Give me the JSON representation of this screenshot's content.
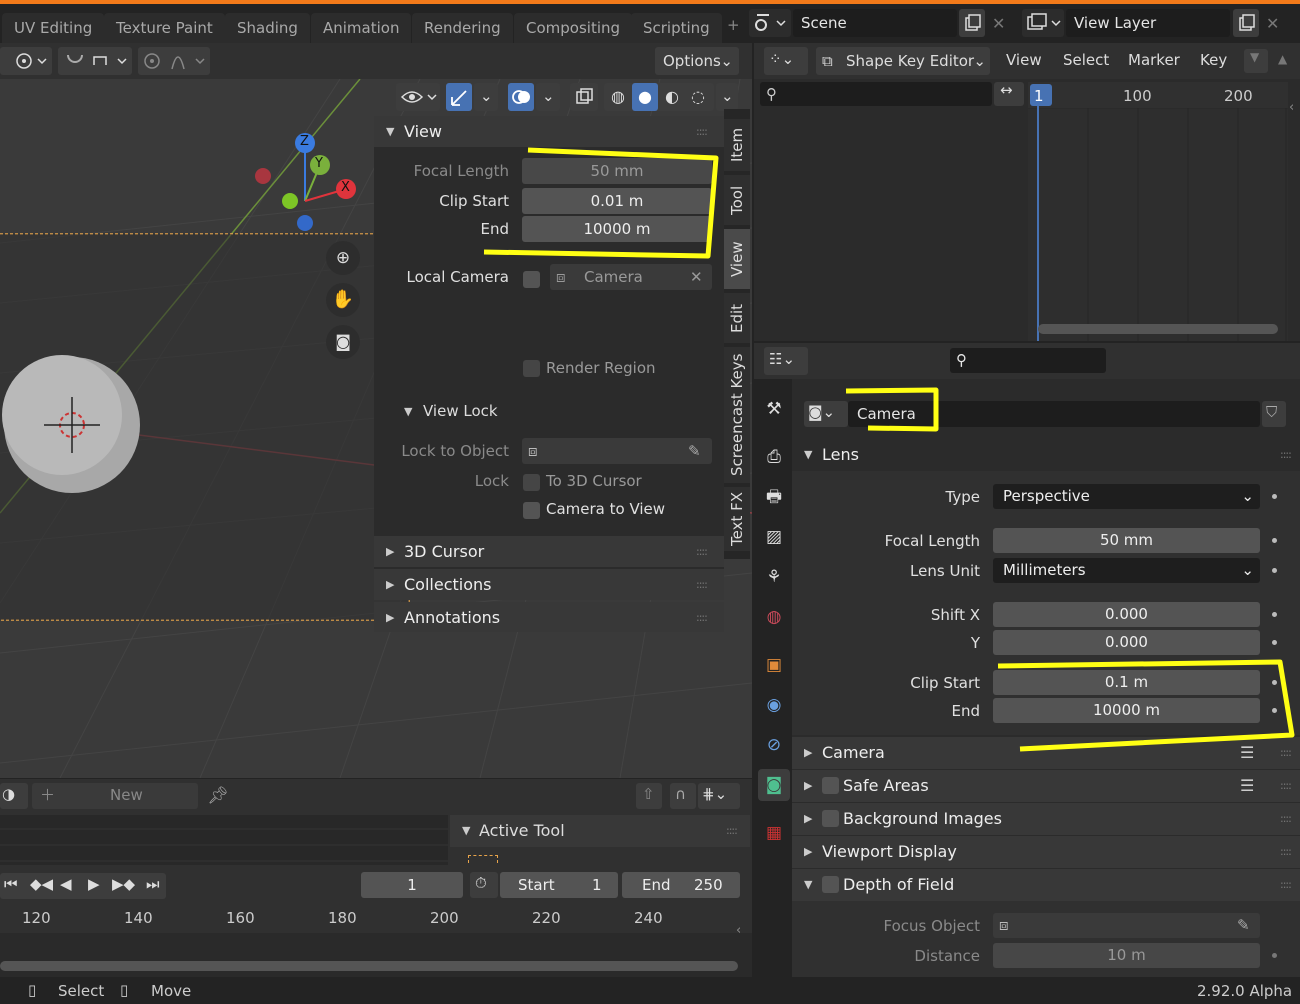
{
  "workspace_tabs": [
    "UV Editing",
    "Texture Paint",
    "Shading",
    "Animation",
    "Rendering",
    "Compositing",
    "Scripting"
  ],
  "scene": {
    "name": "Scene",
    "view_layer": "View Layer"
  },
  "viewport": {
    "options_label": "Options",
    "sidebar_tabs": [
      "Item",
      "Tool",
      "View",
      "Edit",
      "Screencast Keys",
      "Text FX"
    ],
    "active_sidebar_tab": "View",
    "gizmo": {
      "z": "Z",
      "y": "Y",
      "x": "X"
    },
    "view_panel": {
      "title": "View",
      "focal_length_label": "Focal Length",
      "focal_length": "50 mm",
      "clip_start_label": "Clip Start",
      "clip_start": "0.01 m",
      "end_label": "End",
      "end": "10000 m",
      "local_camera_label": "Local Camera",
      "local_camera_value": "Camera",
      "render_region_label": "Render Region",
      "view_lock": {
        "title": "View Lock",
        "lock_to_object_label": "Lock to Object",
        "lock_label": "Lock",
        "to_3d_cursor_label": "To 3D Cursor",
        "camera_to_view_label": "Camera to View"
      }
    },
    "collapsed_panels": [
      "3D Cursor",
      "Collections",
      "Annotations"
    ]
  },
  "timeline": {
    "new_label": "New",
    "active_tool_label": "Active Tool",
    "current_frame": "1",
    "start_label": "Start",
    "start": "1",
    "end_label": "End",
    "end": "250",
    "ruler": [
      "120",
      "140",
      "160",
      "180",
      "200",
      "220",
      "240"
    ]
  },
  "dopesheet": {
    "mode": "Shape Key Editor",
    "menus": [
      "View",
      "Select",
      "Marker",
      "Key"
    ],
    "current_frame": "1",
    "ruler": [
      "100",
      "200"
    ]
  },
  "properties": {
    "data_name": "Camera",
    "lens": {
      "title": "Lens",
      "type_label": "Type",
      "type": "Perspective",
      "focal_length_label": "Focal Length",
      "focal_length": "50 mm",
      "lens_unit_label": "Lens Unit",
      "lens_unit": "Millimeters",
      "shift_x_label": "Shift X",
      "shift_x": "0.000",
      "y_label": "Y",
      "shift_y": "0.000",
      "clip_start_label": "Clip Start",
      "clip_start": "0.1 m",
      "end_label": "End",
      "end": "10000 m"
    },
    "sections": {
      "camera": "Camera",
      "safe_areas": "Safe Areas",
      "background_images": "Background Images",
      "viewport_display": "Viewport Display",
      "depth_of_field": "Depth of Field"
    },
    "dof": {
      "focus_object_label": "Focus Object",
      "distance_label": "Distance",
      "distance": "10 m"
    }
  },
  "status": {
    "select": "Select",
    "move": "Move",
    "version": "2.92.0 Alpha"
  },
  "colors": {
    "accent_orange": "#f27a1a",
    "highlight_yellow": "#ffff14",
    "active_blue": "#4772b3",
    "playhead": "#4772b3"
  }
}
